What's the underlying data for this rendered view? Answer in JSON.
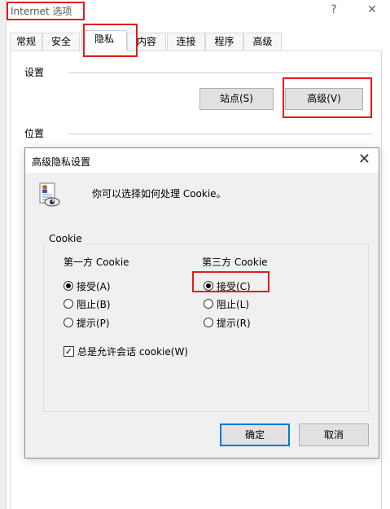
{
  "main": {
    "title": "Internet 选项",
    "help_glyph": "?",
    "close_glyph": "✕",
    "tabs": [
      {
        "label": "常规"
      },
      {
        "label": "安全"
      },
      {
        "label": "隐私"
      },
      {
        "label": "内容"
      },
      {
        "label": "连接"
      },
      {
        "label": "程序"
      },
      {
        "label": "高级"
      }
    ],
    "active_tab": "隐私",
    "settings_label": "设置",
    "sites_button": "站点(S)",
    "advanced_button": "高级(V)",
    "location_label": "位置"
  },
  "dialog": {
    "title": "高级隐私设置",
    "close_glyph": "✕",
    "description": "你可以选择如何处理 Cookie。",
    "group_label": "Cookie",
    "first_party": {
      "heading": "第一方 Cookie",
      "options": [
        {
          "label": "接受(A)",
          "checked": true
        },
        {
          "label": "阻止(B)",
          "checked": false
        },
        {
          "label": "提示(P)",
          "checked": false
        }
      ]
    },
    "third_party": {
      "heading": "第三方 Cookie",
      "options": [
        {
          "label": "接受(C)",
          "checked": true
        },
        {
          "label": "阻止(L)",
          "checked": false
        },
        {
          "label": "提示(R)",
          "checked": false
        }
      ]
    },
    "session_cookie": {
      "label": "总是允许会话 cookie(W)",
      "checked": true,
      "check_glyph": "✓"
    },
    "ok_button": "确定",
    "cancel_button": "取消"
  },
  "colors": {
    "highlight_box": "#e31b1b",
    "dialog_bg": "#f0f0f0",
    "default_button_border": "#0078d7"
  }
}
